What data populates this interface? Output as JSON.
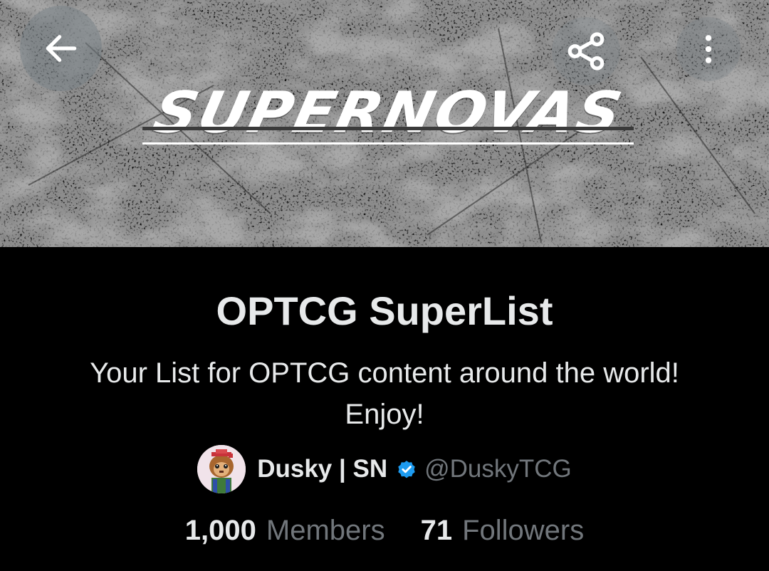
{
  "banner": {
    "logo_text": "SUPERNOVAS",
    "back_icon": "arrow-left-icon",
    "share_icon": "share-icon",
    "more_icon": "more-vertical-icon"
  },
  "list": {
    "title": "OPTCG SuperList",
    "description_line1": "Your List for OPTCG content around the world!",
    "description_line2": "Enjoy!"
  },
  "owner": {
    "name": "Dusky | SN",
    "handle": "@DuskyTCG",
    "verified_color": "#1d9bf0"
  },
  "stats": {
    "members_count": "1,000",
    "members_label": "Members",
    "followers_count": "71",
    "followers_label": "Followers"
  },
  "colors": {
    "background": "#000000",
    "primary_text": "#e7e9ea",
    "secondary_text": "#71767b"
  }
}
